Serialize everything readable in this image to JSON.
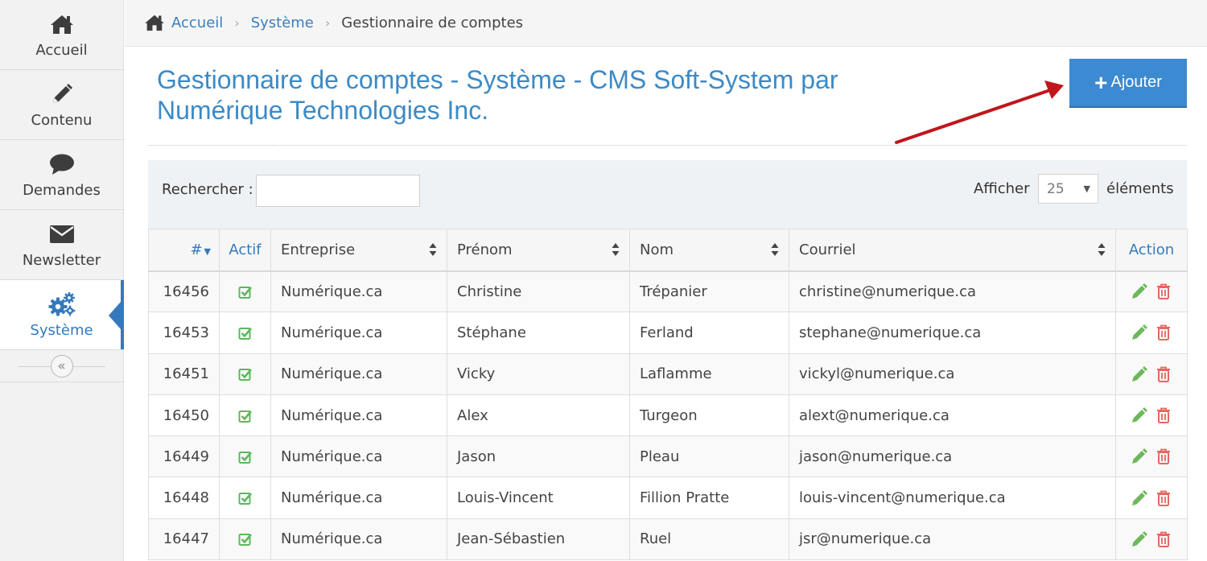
{
  "sidebar": {
    "items": [
      {
        "label": "Accueil",
        "icon": "home-icon"
      },
      {
        "label": "Contenu",
        "icon": "pencil-icon"
      },
      {
        "label": "Demandes",
        "icon": "speech-bubble-icon"
      },
      {
        "label": "Newsletter",
        "icon": "envelope-icon"
      },
      {
        "label": "Système",
        "icon": "gears-icon",
        "active": true
      }
    ],
    "collapse_glyph": "«"
  },
  "breadcrumb": {
    "home": "Accueil",
    "section": "Système",
    "current": "Gestionnaire de comptes",
    "separator": "›"
  },
  "page": {
    "title": "Gestionnaire de comptes - Système - CMS Soft-System par Numérique Technologies Inc.",
    "add_label": "Ajouter",
    "add_glyph": "+"
  },
  "controls": {
    "search_label": "Rechercher :",
    "search_value": "",
    "show_label": "Afficher",
    "page_size": "25",
    "elements_label": "éléments"
  },
  "table": {
    "headers": {
      "id": "#",
      "active": "Actif",
      "company": "Entreprise",
      "first_name": "Prénom",
      "last_name": "Nom",
      "email": "Courriel",
      "action": "Action"
    },
    "rows": [
      {
        "id": "16456",
        "active": true,
        "company": "Numérique.ca",
        "first_name": "Christine",
        "last_name": "Trépanier",
        "email": "christine@numerique.ca"
      },
      {
        "id": "16453",
        "active": true,
        "company": "Numérique.ca",
        "first_name": "Stéphane",
        "last_name": "Ferland",
        "email": "stephane@numerique.ca"
      },
      {
        "id": "16451",
        "active": true,
        "company": "Numérique.ca",
        "first_name": "Vicky",
        "last_name": "Laflamme",
        "email": "vickyl@numerique.ca"
      },
      {
        "id": "16450",
        "active": true,
        "company": "Numérique.ca",
        "first_name": "Alex",
        "last_name": "Turgeon",
        "email": "alext@numerique.ca"
      },
      {
        "id": "16449",
        "active": true,
        "company": "Numérique.ca",
        "first_name": "Jason",
        "last_name": "Pleau",
        "email": "jason@numerique.ca"
      },
      {
        "id": "16448",
        "active": true,
        "company": "Numérique.ca",
        "first_name": "Louis-Vincent",
        "last_name": "Fillion Pratte",
        "email": "louis-vincent@numerique.ca"
      },
      {
        "id": "16447",
        "active": true,
        "company": "Numérique.ca",
        "first_name": "Jean-Sébastien",
        "last_name": "Ruel",
        "email": "jsr@numerique.ca"
      }
    ]
  },
  "colors": {
    "accent": "#3579bd",
    "title": "#3c8ac6",
    "button": "#3c8ad1",
    "check": "#5cb85c",
    "edit": "#6cb85a",
    "delete": "#e4675e",
    "annotation_arrow": "#c0161b"
  }
}
